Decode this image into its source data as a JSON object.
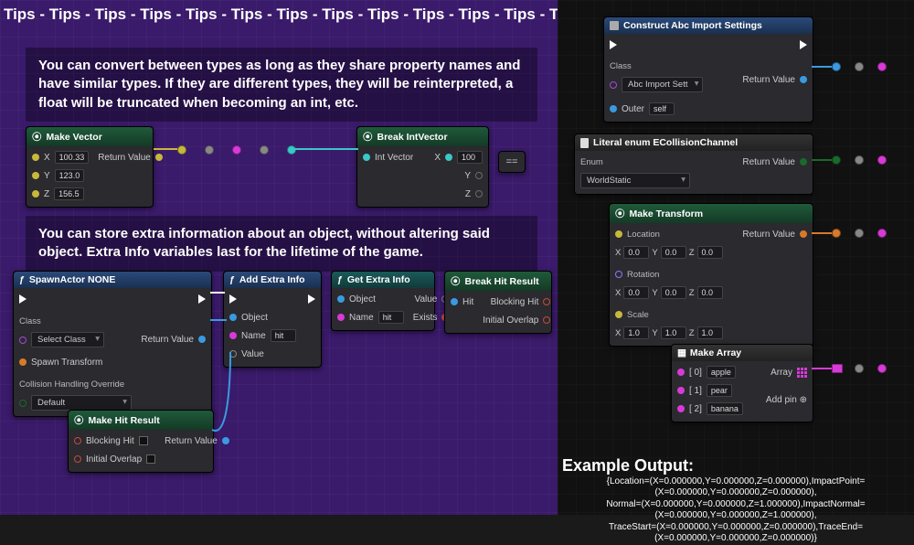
{
  "header": {
    "tips_text": "Tips - Tips - Tips - Tips - Tips - Tips - Tips - Tips - Tips - Tips - Tips - Tips - Tips - Tips"
  },
  "comments": {
    "c1": "You can convert between types as long as they share property names and have similar types. If they are different types, they will be reinterpreted, a float will be truncated when becoming an int, etc.",
    "c2": "You can store extra information about an object, without altering said object. Extra Info variables last for the lifetime of the game."
  },
  "nodes": {
    "makeVector": {
      "title": "Make Vector",
      "pins": {
        "x_label": "X",
        "y_label": "Y",
        "z_label": "Z",
        "x": "100.33",
        "y": "123.0",
        "z": "156.5",
        "ret": "Return Value"
      }
    },
    "breakIntVector": {
      "title": "Break IntVector",
      "pins": {
        "in": "Int Vector",
        "x": "X",
        "y": "Y",
        "z": "Z",
        "x_val": "100"
      }
    },
    "spawnActor": {
      "title": "SpawnActor NONE",
      "class_label": "Class",
      "class_value": "Select Class",
      "spawn_transform": "Spawn Transform",
      "collision_label": "Collision Handling Override",
      "collision_value": "Default",
      "ret": "Return Value"
    },
    "addExtra": {
      "title": "Add Extra Info",
      "object": "Object",
      "name_label": "Name",
      "name_value": "hit",
      "value": "Value"
    },
    "getExtra": {
      "title": "Get Extra Info",
      "object": "Object",
      "name_label": "Name",
      "name_value": "hit",
      "value": "Value",
      "exists": "Exists"
    },
    "breakHit": {
      "title": "Break Hit Result",
      "hit": "Hit",
      "blocking": "Blocking Hit",
      "initial": "Initial Overlap"
    },
    "makeHit": {
      "title": "Make Hit Result",
      "blocking": "Blocking Hit",
      "initial": "Initial Overlap",
      "ret": "Return Value"
    },
    "constructAbc": {
      "title": "Construct Abc Import Settings",
      "class_label": "Class",
      "class_value": "Abc Import Sett",
      "outer_label": "Outer",
      "outer_value": "self",
      "ret": "Return Value"
    },
    "literalEnum": {
      "title": "Literal enum ECollisionChannel",
      "enum_label": "Enum",
      "enum_value": "WorldStatic",
      "ret": "Return Value"
    },
    "makeTransform": {
      "title": "Make Transform",
      "loc_label": "Location",
      "rot_label": "Rotation",
      "scale_label": "Scale",
      "x_label": "X",
      "y_label": "Y",
      "z_label": "Z",
      "loc": {
        "x": "0.0",
        "y": "0.0",
        "z": "0.0"
      },
      "rot": {
        "x": "0.0",
        "y": "0.0",
        "z": "0.0"
      },
      "scale": {
        "x": "1.0",
        "y": "1.0",
        "z": "1.0"
      },
      "ret": "Return Value"
    },
    "makeArray": {
      "title": "Make Array",
      "items": [
        {
          "idx": "[ 0]",
          "val": "apple"
        },
        {
          "idx": "[ 1]",
          "val": "pear"
        },
        {
          "idx": "[ 2]",
          "val": "banana"
        }
      ],
      "array_label": "Array",
      "addpin": "Add pin"
    }
  },
  "output": {
    "title": "Example Output:",
    "line1": "{Location=(X=0.000000,Y=0.000000,Z=0.000000),ImpactPoint=(X=0.000000,Y=0.000000,Z=0.000000),",
    "line2": "Normal=(X=0.000000,Y=0.000000,Z=1.000000),ImpactNormal=(X=0.000000,Y=0.000000,Z=1.000000),",
    "line3": "TraceStart=(X=0.000000,Y=0.000000,Z=0.000000),TraceEnd=(X=0.000000,Y=0.000000,Z=0.000000)}"
  }
}
